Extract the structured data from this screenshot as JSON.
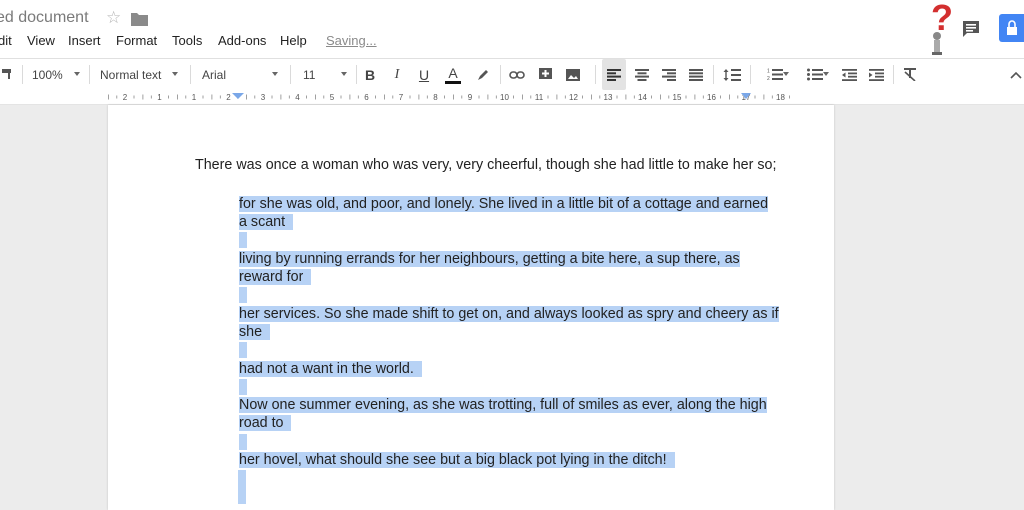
{
  "doc": {
    "title": "ed document",
    "saving": "Saving..."
  },
  "menu": [
    "dit",
    "View",
    "Insert",
    "Format",
    "Tools",
    "Add-ons",
    "Help"
  ],
  "toolbar": {
    "zoom": "100%",
    "style": "Normal text",
    "font": "Arial",
    "size": "11"
  },
  "ruler": {
    "numbers": [
      "2",
      "1",
      "1",
      "2",
      "3",
      "4",
      "5",
      "6",
      "7",
      "8",
      "9",
      "10",
      "11",
      "12",
      "13",
      "14",
      "15",
      "16",
      "17",
      "18"
    ]
  },
  "body": {
    "first_line": "There was once a woman who was very, very cheerful, though she had little to make her so;",
    "lines": [
      "for she was old, and poor, and lonely. She lived in a little bit of a cottage and earned",
      "a scant",
      "living by running errands for her neighbours, getting a bite here, a sup there, as",
      "reward for",
      "her services. So she made shift to get on, and always looked as spry and cheery as if",
      "she",
      "had not a want in the world.",
      "Now one summer evening, as she was trotting, full of smiles as ever, along the high",
      "road to",
      "her hovel, what should she see but a big black pot lying in the ditch!"
    ]
  },
  "colors": {
    "highlight": "#b7d2f5",
    "share": "#4285f4",
    "logo_red": "#d32f2f"
  },
  "icons": [
    "star-icon",
    "folder-icon",
    "comment-icon",
    "lock-icon",
    "paint-format-icon",
    "bold-icon",
    "italic-icon",
    "underline-icon",
    "text-color-icon",
    "highlight-icon",
    "link-icon",
    "comment-add-icon",
    "image-icon",
    "align-left-icon",
    "align-center-icon",
    "align-right-icon",
    "justify-icon",
    "line-spacing-icon",
    "numbered-list-icon",
    "bulleted-list-icon",
    "decrease-indent-icon",
    "increase-indent-icon",
    "clear-formatting-icon",
    "collapse-icon"
  ]
}
